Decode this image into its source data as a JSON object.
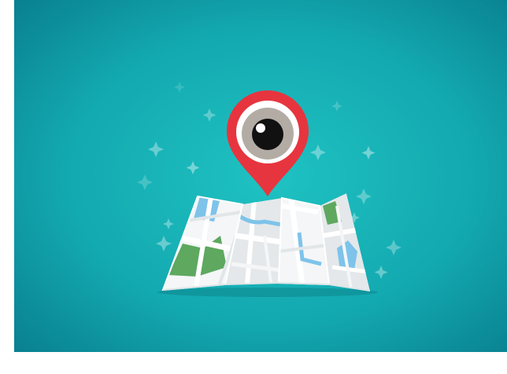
{
  "scene": {
    "background_center_color": "#1fc2c2",
    "background_edge_color": "#087c8c",
    "pin_color": "#e6353f",
    "pin_ring_color": "#ffffff",
    "iris_color": "#b3aca5",
    "pupil_color": "#111111",
    "map_paper_color": "#f4f6f7",
    "map_road_color": "#ffffff",
    "water_color": "#7ec3ea",
    "park_color": "#5ea860"
  },
  "icons": {
    "pin": "location-pin-icon",
    "eye": "eye-icon",
    "map": "folded-map-icon",
    "sparkle": "sparkle-icon"
  }
}
